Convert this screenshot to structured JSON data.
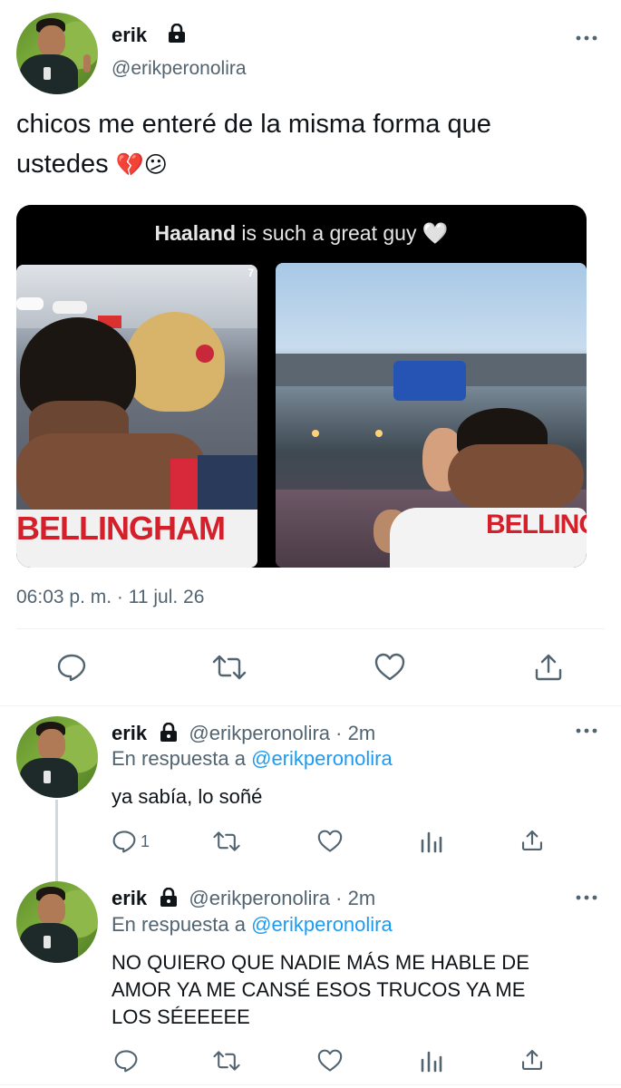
{
  "main_tweet": {
    "name": "erik",
    "handle": "@erikperonolira",
    "text_line1": "chicos me enteré de la misma forma que",
    "text_line2": "ustedes",
    "emoji": "💔😕",
    "image_caption_bold": "Haaland",
    "image_caption_rest": " is such a great guy 🤍",
    "image_jersey_left": "BELLINGHAM",
    "image_jersey_right": "BELLING",
    "image_overlay_digit": "7",
    "timestamp": "06:03 p. m. · 11 jul. 26",
    "actions": [
      "reply-icon",
      "retweet-icon",
      "like-icon",
      "share-icon"
    ]
  },
  "replies": [
    {
      "name": "erik",
      "handle": "@erikperonolira",
      "time": "· 2m",
      "reply_prefix": "En respuesta a",
      "reply_to": "@erikperonolira",
      "text_lines": [
        "ya sabía, lo soñé"
      ],
      "reply_count": "1"
    },
    {
      "name": "erik",
      "handle": "@erikperonolira",
      "time": "· 2m",
      "reply_prefix": "En respuesta a",
      "reply_to": "@erikperonolira",
      "text_lines": [
        "NO QUIERO QUE NADIE MÁS ME HABLE DE",
        "AMOR YA ME CANSÉ ESOS TRUCOS YA ME",
        "LOS SÉEEEEE"
      ],
      "reply_count": ""
    }
  ],
  "colors": {
    "link": "#1d9bf0",
    "secondary": "#536471",
    "divider": "#eff3f4"
  }
}
